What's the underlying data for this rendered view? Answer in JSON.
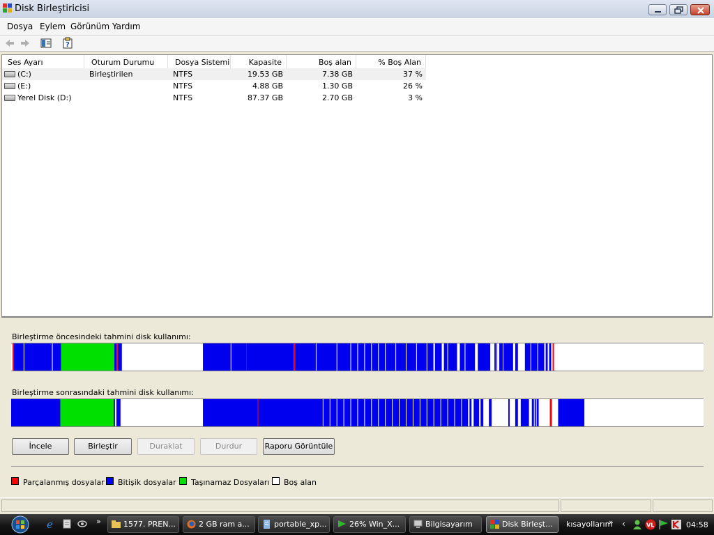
{
  "window": {
    "title": "Disk Birleştiricisi"
  },
  "menu": [
    "Dosya",
    "Eylem",
    "Görünüm",
    "Yardım"
  ],
  "columns": [
    "Ses Ayarı",
    "Oturum Durumu",
    "Dosya Sistemi",
    "Kapasite",
    "Boş alan",
    "% Boş Alan"
  ],
  "volumes": [
    {
      "name": "(C:)",
      "status": "Birleştirilen",
      "fs": "NTFS",
      "capacity": "19.53 GB",
      "free": "7.38 GB",
      "free_pct": "37 %"
    },
    {
      "name": "(E:)",
      "status": "",
      "fs": "NTFS",
      "capacity": "4.88 GB",
      "free": "1.30 GB",
      "free_pct": "26 %"
    },
    {
      "name": "Yerel Disk (D:)",
      "status": "",
      "fs": "NTFS",
      "capacity": "87.37 GB",
      "free": "2.70 GB",
      "free_pct": "3 %"
    }
  ],
  "before_label": "Birleştirme öncesindeki tahmini disk kullanımı:",
  "after_label": "Birleştirme sonrasındaki tahmini disk kullanımı:",
  "buttons": {
    "analyze": "İncele",
    "defrag": "Birleştir",
    "pause": "Duraklat",
    "stop": "Durdur",
    "report": "Raporu Görüntüle"
  },
  "legend": [
    {
      "label": "Parçalanmış dosyalar",
      "color": "#ff0000"
    },
    {
      "label": "Bitişik dosyalar",
      "color": "#0000ff"
    },
    {
      "label": "Taşınamaz Dosyaları",
      "color": "#00e000"
    },
    {
      "label": "Boş alan",
      "color": "#ffffff"
    }
  ],
  "taskbar": {
    "tasks": [
      {
        "label": "1577. PREN...",
        "icon": "folder-icon"
      },
      {
        "label": "2 GB ram a...",
        "icon": "firefox-icon"
      },
      {
        "label": "portable_xp...",
        "icon": "document-icon"
      },
      {
        "label": "26% Win_X...",
        "icon": "download-flag-icon"
      },
      {
        "label": "Bilgisayarım",
        "icon": "computer-icon"
      },
      {
        "label": "Disk Birleşt...",
        "icon": "defrag-icon"
      }
    ],
    "shortcuts_label": "kısayollarım",
    "clock": "04:58"
  },
  "colors": {
    "fragmented": "#ff0000",
    "contiguous": "#0000ee",
    "unmovable": "#00e000",
    "free": "#ffffff"
  },
  "diskmap_before": [
    [
      "white",
      0,
      0.002
    ],
    [
      "red",
      0.002,
      0.004
    ],
    [
      "blue",
      0.004,
      0.072
    ],
    [
      "green",
      0.072,
      0.149
    ],
    [
      "blue",
      0.149,
      0.152
    ],
    [
      "red",
      0.152,
      0.154
    ],
    [
      "blue",
      0.154,
      0.16
    ],
    [
      "white",
      0.16,
      0.277
    ],
    [
      "blue",
      0.277,
      0.34
    ],
    [
      "blue",
      0.34,
      0.408
    ],
    [
      "red",
      0.408,
      0.41
    ],
    [
      "blue",
      0.41,
      0.61
    ],
    [
      "white",
      0.61,
      0.612
    ],
    [
      "blue",
      0.612,
      0.622
    ],
    [
      "white",
      0.622,
      0.625
    ],
    [
      "blue",
      0.625,
      0.644
    ],
    [
      "white",
      0.644,
      0.648
    ],
    [
      "blue",
      0.648,
      0.67
    ],
    [
      "white",
      0.67,
      0.674
    ],
    [
      "blue",
      0.674,
      0.692
    ],
    [
      "white",
      0.692,
      0.698
    ],
    [
      "blue",
      0.698,
      0.702
    ],
    [
      "white",
      0.702,
      0.705
    ],
    [
      "blue",
      0.705,
      0.725
    ],
    [
      "white",
      0.725,
      0.728
    ],
    [
      "blue",
      0.728,
      0.732
    ],
    [
      "white",
      0.732,
      0.742
    ],
    [
      "blue",
      0.742,
      0.77
    ],
    [
      "white",
      0.77,
      0.772
    ],
    [
      "blue",
      0.772,
      0.775
    ],
    [
      "white",
      0.775,
      0.777
    ],
    [
      "blue",
      0.777,
      0.78
    ],
    [
      "white",
      0.78,
      0.782
    ],
    [
      "red",
      0.782,
      0.784
    ],
    [
      "white",
      0.784,
      1
    ]
  ],
  "diskmap_after": [
    [
      "blue",
      0,
      0.071
    ],
    [
      "green",
      0.071,
      0.148
    ],
    [
      "blue",
      0.148,
      0.15
    ],
    [
      "white",
      0.15,
      0.152
    ],
    [
      "blue",
      0.152,
      0.158
    ],
    [
      "white",
      0.158,
      0.277
    ],
    [
      "blue",
      0.277,
      0.356
    ],
    [
      "red",
      0.356,
      0.357
    ],
    [
      "blue",
      0.357,
      0.66
    ],
    [
      "white",
      0.66,
      0.662
    ],
    [
      "blue",
      0.662,
      0.665
    ],
    [
      "white",
      0.665,
      0.668
    ],
    [
      "blue",
      0.668,
      0.676
    ],
    [
      "white",
      0.676,
      0.678
    ],
    [
      "blue",
      0.678,
      0.682
    ],
    [
      "white",
      0.682,
      0.69
    ],
    [
      "blue",
      0.69,
      0.694
    ],
    [
      "white",
      0.694,
      0.718
    ],
    [
      "blue",
      0.718,
      0.72
    ],
    [
      "white",
      0.72,
      0.728
    ],
    [
      "blue",
      0.728,
      0.732
    ],
    [
      "white",
      0.732,
      0.736
    ],
    [
      "blue",
      0.736,
      0.748
    ],
    [
      "white",
      0.748,
      0.752
    ],
    [
      "blue",
      0.752,
      0.762
    ],
    [
      "white",
      0.762,
      0.778
    ],
    [
      "red",
      0.778,
      0.781
    ],
    [
      "white",
      0.781,
      0.79
    ],
    [
      "blue",
      0.79,
      0.828
    ],
    [
      "white",
      0.828,
      1
    ]
  ]
}
